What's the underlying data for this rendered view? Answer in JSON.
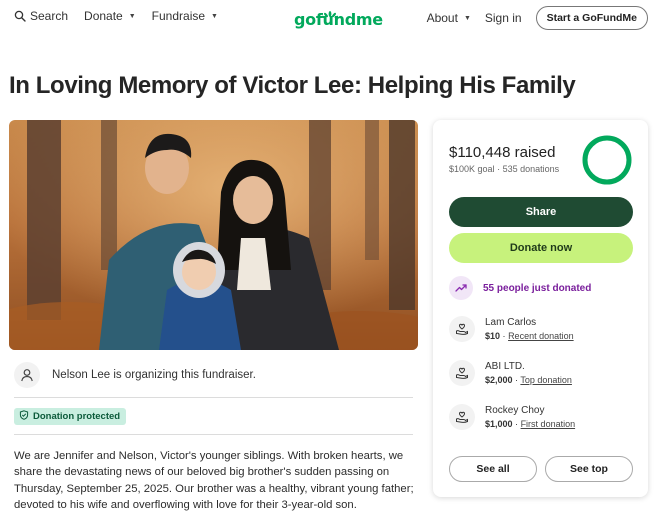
{
  "nav": {
    "search_label": "Search",
    "donate_label": "Donate",
    "fundraise_label": "Fundraise",
    "logo_text": "gofundme",
    "about_label": "About",
    "signin_label": "Sign in",
    "start_label": "Start a GoFundMe"
  },
  "page": {
    "title": "In Loving Memory of Victor Lee: Helping His Family"
  },
  "organizer": {
    "text": "Nelson Lee is organizing this fundraiser."
  },
  "badge": {
    "protected_label": "Donation protected"
  },
  "story": {
    "text": "We are Jennifer and Nelson, Victor's younger siblings. With broken hearts, we share the devastating news of our beloved big brother's sudden passing on Thursday, September 25, 2025. Our brother was a healthy, vibrant young father; devoted to his wife and overflowing with love for their 3-year-old son."
  },
  "card": {
    "raised_amount": "$110,448",
    "raised_word": "raised",
    "goal": "$100K goal",
    "sep": "·",
    "donations": "535 donations",
    "progress_fraction": 1.0,
    "share_label": "Share",
    "donate_label": "Donate now",
    "just_donated": "55 people just donated",
    "donors": [
      {
        "name": "Lam Carlos",
        "amount": "$10",
        "sep": "·",
        "tag": "Recent donation"
      },
      {
        "name": "ABI LTD.",
        "amount": "$2,000",
        "sep": "·",
        "tag": "Top donation"
      },
      {
        "name": "Rockey Choy",
        "amount": "$1,000",
        "sep": "·",
        "tag": "First donation"
      }
    ],
    "see_all_label": "See all",
    "see_top_label": "See top"
  },
  "colors": {
    "brand_green": "#02a95c",
    "share_bg": "#1f4b33",
    "donate_bg": "#c7f27c",
    "progress_ring": "#02a95c",
    "just_donated_text": "#7a1f9c",
    "protected_bg": "#c9eee0"
  },
  "icons": {
    "search": "search-icon",
    "caret": "chevron-down-icon",
    "logo_sprout": "sprout-icon",
    "organizer": "person-icon",
    "protected": "shield-check-icon",
    "trending": "trending-up-icon",
    "donor": "heart-hand-icon"
  }
}
